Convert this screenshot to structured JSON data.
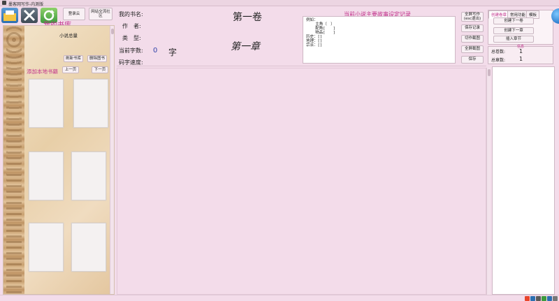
{
  "window": {
    "title": "墨客网写作-内测版"
  },
  "toolbar": {
    "login_label": "登录云",
    "forum_label": "网站交流社区"
  },
  "library": {
    "title": "我的书库",
    "total_label": "小说总量",
    "refresh_label": "刷新书库",
    "delete_label": "删除图书",
    "add_local_label": "添加本地书籍",
    "prev_label": "上一页",
    "next_label": "下一页"
  },
  "book_info": {
    "name_label": "我的书名:",
    "author_label": "作　者:",
    "type_label": "类　型:",
    "word_count_label": "当前字数:",
    "word_count_value": "0",
    "word_unit": "字",
    "speed_label": "码字速度:"
  },
  "headings": {
    "volume": "第一卷",
    "chapter": "第一章"
  },
  "notes": {
    "title": "当前小说主要故事设定记录",
    "content": "例如：\n    主角（　）\n    配角[　　]\n    物品[　　]\n历史：[]\n地理：[]\n宗派：[]"
  },
  "actions": {
    "fullscreen_label": "全屏写作\n(esc退出)",
    "save_record_label": "保存记录",
    "cut_screenshot_label": "切作截图",
    "full_screenshot_label": "全屏截图",
    "save_label": "保存"
  },
  "right_panel": {
    "tabs": [
      "创建卷章",
      "常用功能",
      "模板"
    ],
    "create_volume_label": "创建下一卷",
    "create_chapter_label": "创建下一章",
    "insert_chapter_label": "插入章节",
    "total_volumes_label": "总卷数:",
    "total_volumes_value": "1",
    "total_chapters_label": "总章数:",
    "total_chapters_value": "1",
    "info_tag": "信息"
  },
  "colors": {
    "accent": "#c0308a",
    "background": "#f3dcea"
  }
}
